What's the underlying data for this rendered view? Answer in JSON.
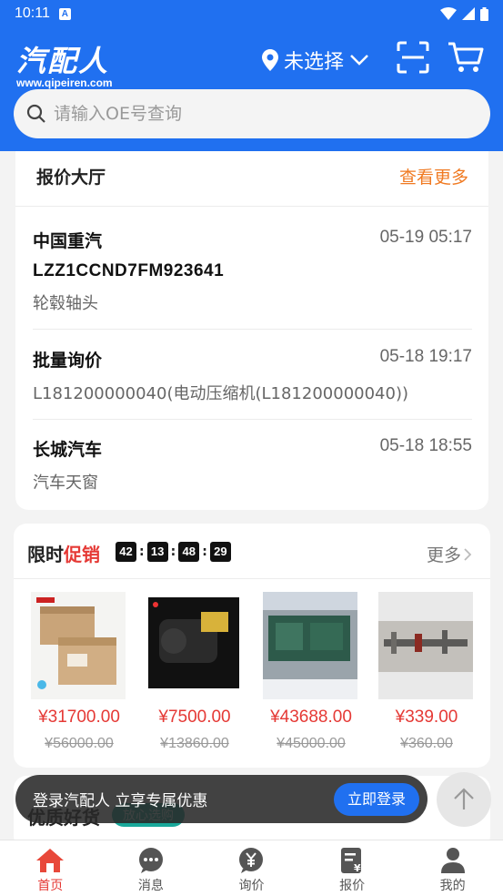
{
  "status_bar": {
    "time": "10:11",
    "notif": "A"
  },
  "header": {
    "logo_cn": "汽配人",
    "logo_en": "www.qipeiren.com",
    "location": "未选择",
    "search_placeholder": "请输入OE号查询"
  },
  "quote_hall": {
    "title": "报价大厅",
    "more": "查看更多",
    "items": [
      {
        "name": "中国重汽",
        "time": "05-19 05:17",
        "vin": "LZZ1CCND7FM923641",
        "desc": "轮毂轴头"
      },
      {
        "name": "批量询价",
        "time": "05-18 19:17",
        "desc": "L181200000040(电动压缩机(L181200000040))"
      },
      {
        "name": "长城汽车",
        "time": "05-18 18:55",
        "desc": "汽车天窗"
      }
    ]
  },
  "flash_sale": {
    "title_black": "限时",
    "title_red": "促销",
    "timer": [
      "42",
      "13",
      "48",
      "29"
    ],
    "more": "更多",
    "products": [
      {
        "price": "¥31700.00",
        "original": "¥56000.00",
        "image": "box-packaging"
      },
      {
        "price": "¥7500.00",
        "original": "¥13860.00",
        "image": "starter-motor"
      },
      {
        "price": "¥43688.00",
        "original": "¥45000.00",
        "image": "engine"
      },
      {
        "price": "¥339.00",
        "original": "¥360.00",
        "image": "shaft-parts"
      }
    ]
  },
  "quality_goods": {
    "title": "优质好货",
    "badge": "放心选购"
  },
  "login_prompt": {
    "text": "登录汽配人 立享专属优惠",
    "button": "立即登录"
  },
  "tabs": [
    {
      "label": "首页",
      "icon": "home-icon",
      "active": true
    },
    {
      "label": "消息",
      "icon": "message-icon",
      "active": false
    },
    {
      "label": "询价",
      "icon": "yuan-icon",
      "active": false
    },
    {
      "label": "报价",
      "icon": "quote-doc-icon",
      "active": false
    },
    {
      "label": "我的",
      "icon": "user-icon",
      "active": false
    }
  ],
  "colors": {
    "brand_blue": "#2070f0",
    "price_red": "#e53935",
    "more_orange": "#f07a22",
    "badge_teal": "#18a89a"
  }
}
